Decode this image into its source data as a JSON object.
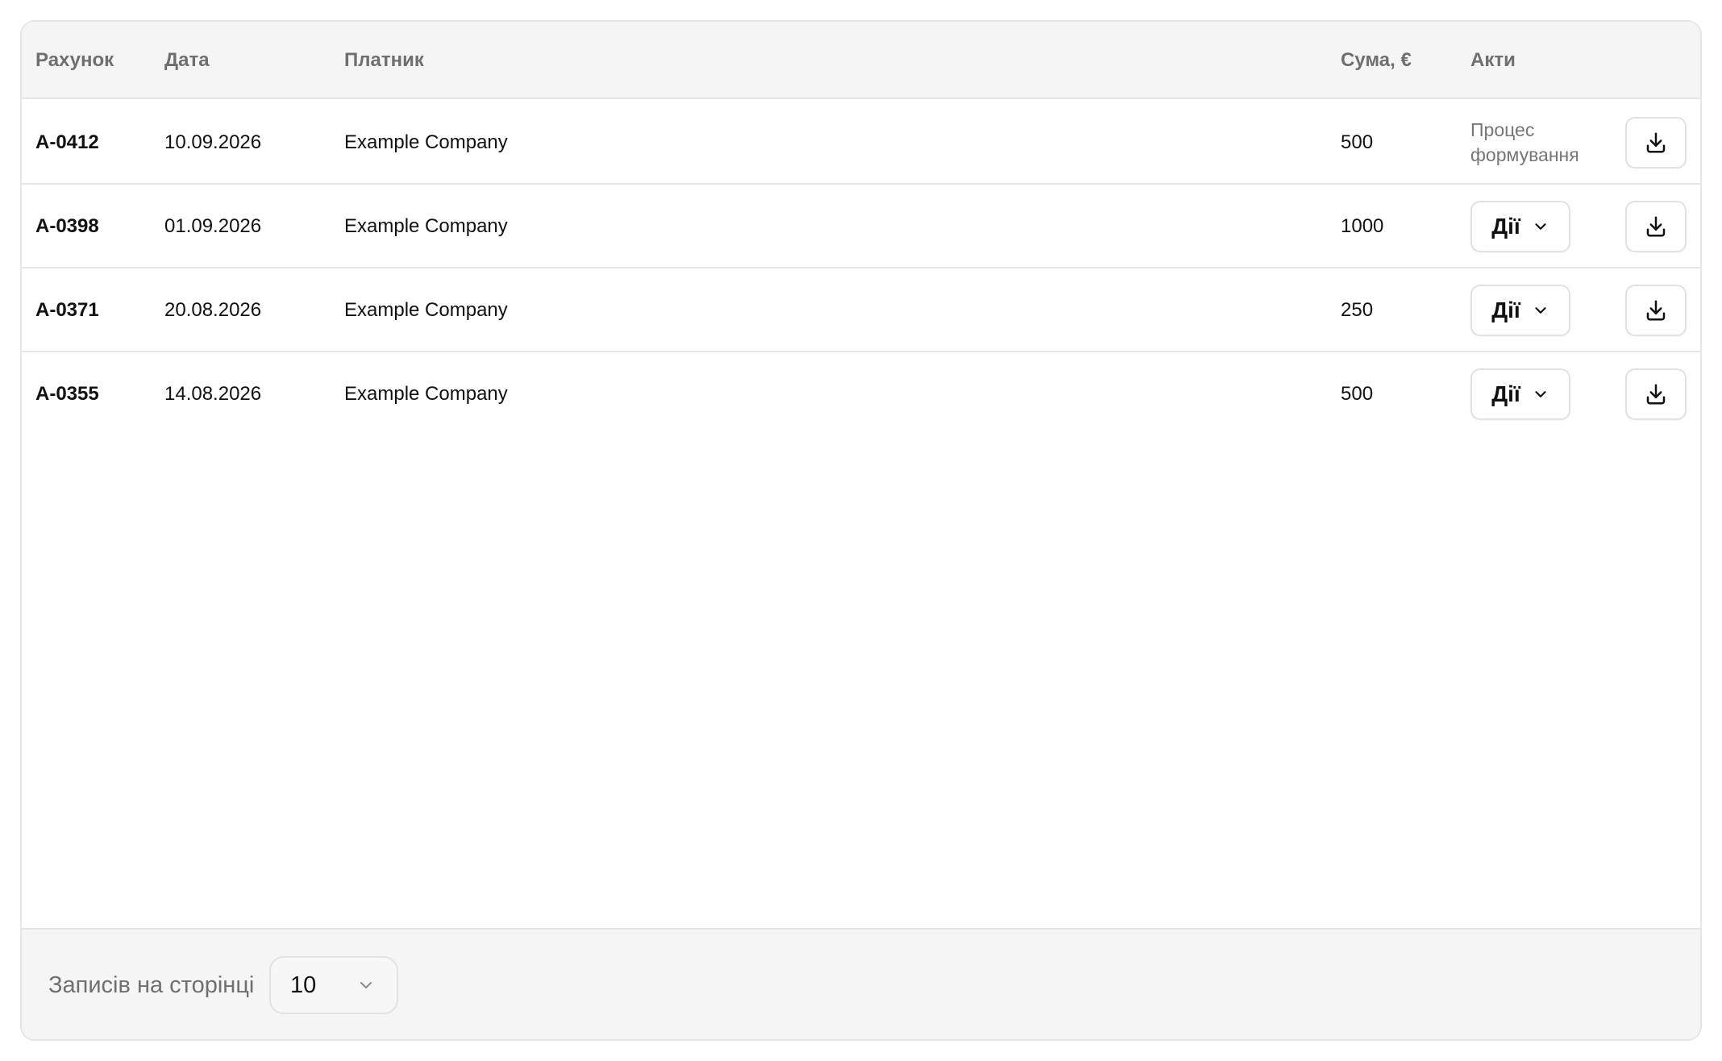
{
  "table": {
    "headers": {
      "invoice": "Рахунок",
      "date": "Дата",
      "payer": "Платник",
      "sum": "Сума, €",
      "acts": "Акти"
    },
    "rows": [
      {
        "invoice": "A-0412",
        "date": "10.09.2026",
        "payer": "Example Company",
        "sum": "500",
        "acts_status": "Процес формування"
      },
      {
        "invoice": "A-0398",
        "date": "01.09.2026",
        "payer": "Example Company",
        "sum": "1000",
        "actions_label": "Дії"
      },
      {
        "invoice": "A-0371",
        "date": "20.08.2026",
        "payer": "Example Company",
        "sum": "250",
        "actions_label": "Дії"
      },
      {
        "invoice": "A-0355",
        "date": "14.08.2026",
        "payer": "Example Company",
        "sum": "500",
        "actions_label": "Дії"
      }
    ]
  },
  "icons": {
    "download": "download-icon",
    "chevron": "chevron-down-icon"
  },
  "footer": {
    "per_page_label": "Записів на сторінці",
    "per_page_value": "10"
  },
  "colors": {
    "header_bg": "#f5f5f5",
    "border": "#e4e4e4",
    "muted_text": "#6f6f6f",
    "text": "#111111"
  }
}
